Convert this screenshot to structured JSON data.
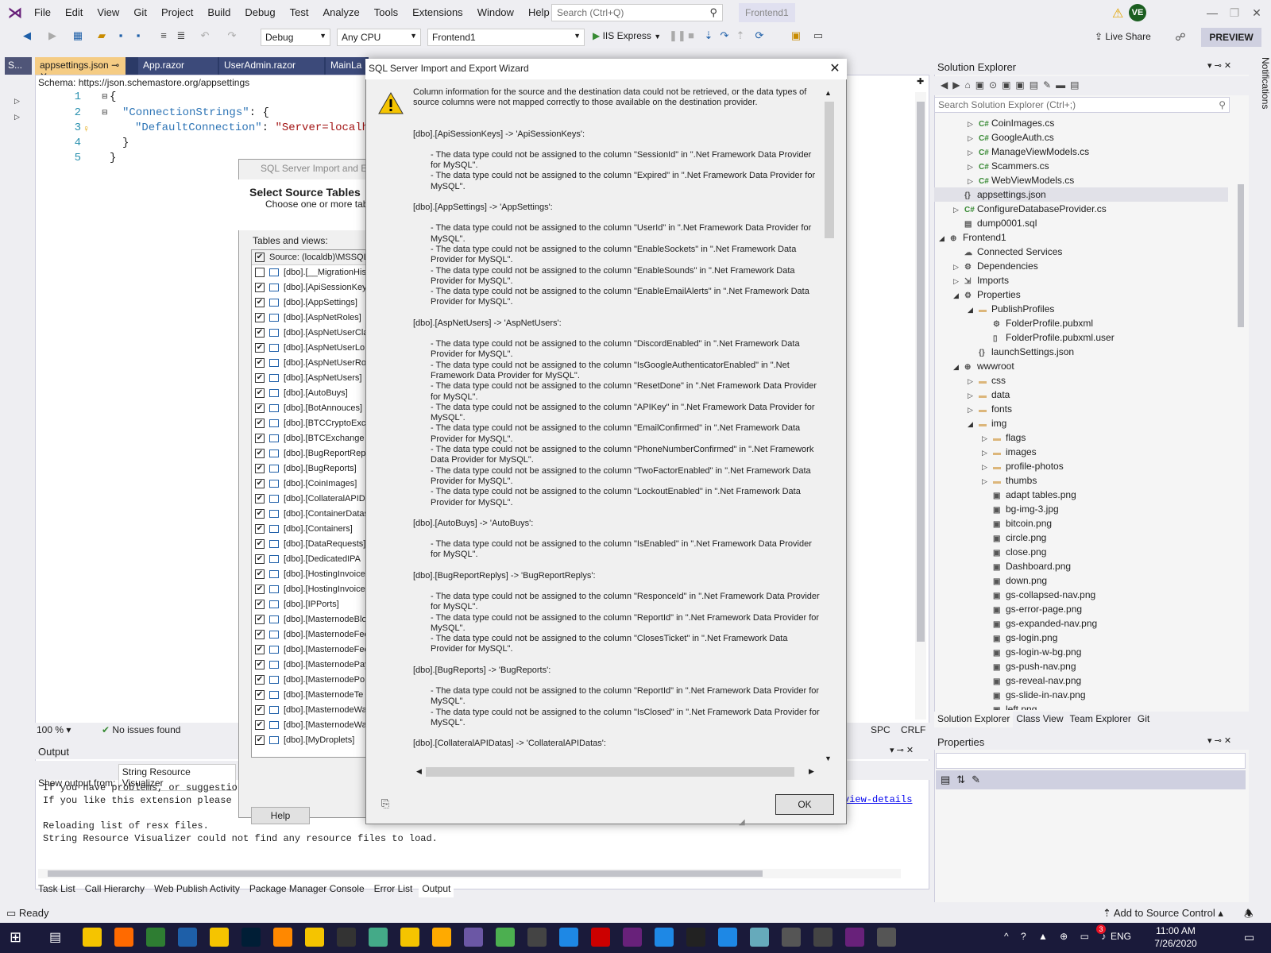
{
  "menu": {
    "items": [
      "File",
      "Edit",
      "View",
      "Git",
      "Project",
      "Build",
      "Debug",
      "Test",
      "Analyze",
      "Tools",
      "Extensions",
      "Window",
      "Help"
    ],
    "search_placeholder": "Search (Ctrl+Q)",
    "solution_name": "Frontend1",
    "avatar_initials": "VE"
  },
  "toolbar": {
    "config": "Debug",
    "platform": "Any CPU",
    "project": "Frontend1",
    "run_label": "IIS Express",
    "live_share": "Live Share",
    "preview": "PREVIEW"
  },
  "editor": {
    "left_tab": "S...",
    "tabs": [
      "appsettings.json",
      "App.razor",
      "UserAdmin.razor",
      "MainLa"
    ],
    "schema_label": "Schema:",
    "schema_url": "https://json.schemastore.org/appsettings",
    "line_numbers": [
      "1",
      "2",
      "3",
      "4",
      "5"
    ],
    "lines": {
      "l1": "{",
      "l2_key": "\"ConnectionStrings\"",
      "l2_rest": ": {",
      "l3_key": "\"DefaultConnection\"",
      "l3_sep": ": ",
      "l3_val": "\"Server=localho",
      "l4": "}",
      "l5": "}"
    },
    "zoom": "100 %",
    "issues": "No issues found",
    "status_right": [
      "SPC",
      "CRLF"
    ]
  },
  "output": {
    "title": "Output",
    "show_from_label": "Show output from:",
    "show_from_value": "String Resource Visualizer",
    "text": "If you have problems, or suggestion\nIf you like this extension please l\n\nReloading list of resx files.\nString Resource Visualizer could not find any resource files to load.",
    "link": "view-details"
  },
  "bottom_tabs": [
    "Task List",
    "Call Hierarchy",
    "Web Publish Activity",
    "Package Manager Console",
    "Error List",
    "Output"
  ],
  "status": {
    "ready": "Ready",
    "source_control": "Add to Source Control"
  },
  "taskbar": {
    "lang": "ENG",
    "time": "11:00 AM",
    "date": "7/26/2020",
    "badge": "3"
  },
  "solution_explorer": {
    "title": "Solution Explorer",
    "search_placeholder": "Search Solution Explorer (Ctrl+;)",
    "items": [
      {
        "indent": 2,
        "tw": "▷",
        "icon": "C#",
        "label": "CoinImages.cs"
      },
      {
        "indent": 2,
        "tw": "▷",
        "icon": "C#",
        "label": "GoogleAuth.cs"
      },
      {
        "indent": 2,
        "tw": "▷",
        "icon": "C#",
        "label": "ManageViewModels.cs"
      },
      {
        "indent": 2,
        "tw": "▷",
        "icon": "C#",
        "label": "Scammers.cs"
      },
      {
        "indent": 2,
        "tw": "▷",
        "icon": "C#",
        "label": "WebViewModels.cs"
      },
      {
        "indent": 1,
        "tw": "",
        "icon": "{}",
        "label": "appsettings.json"
      },
      {
        "indent": 1,
        "tw": "▷",
        "icon": "C#",
        "label": "ConfigureDatabaseProvider.cs"
      },
      {
        "indent": 1,
        "tw": "",
        "icon": "▤",
        "label": "dump0001.sql"
      },
      {
        "indent": 0,
        "tw": "◢",
        "icon": "⊕",
        "label": "Frontend1"
      },
      {
        "indent": 1,
        "tw": "",
        "icon": "☁",
        "label": "Connected Services"
      },
      {
        "indent": 1,
        "tw": "▷",
        "icon": "⚙",
        "label": "Dependencies"
      },
      {
        "indent": 1,
        "tw": "▷",
        "icon": "⇲",
        "label": "Imports"
      },
      {
        "indent": 1,
        "tw": "◢",
        "icon": "⚙",
        "label": "Properties"
      },
      {
        "indent": 2,
        "tw": "◢",
        "icon": "▬",
        "label": "PublishProfiles"
      },
      {
        "indent": 3,
        "tw": "",
        "icon": "⚙",
        "label": "FolderProfile.pubxml"
      },
      {
        "indent": 3,
        "tw": "",
        "icon": "▯",
        "label": "FolderProfile.pubxml.user"
      },
      {
        "indent": 2,
        "tw": "",
        "icon": "{}",
        "label": "launchSettings.json"
      },
      {
        "indent": 1,
        "tw": "◢",
        "icon": "⊕",
        "label": "wwwroot"
      },
      {
        "indent": 2,
        "tw": "▷",
        "icon": "▬",
        "label": "css"
      },
      {
        "indent": 2,
        "tw": "▷",
        "icon": "▬",
        "label": "data"
      },
      {
        "indent": 2,
        "tw": "▷",
        "icon": "▬",
        "label": "fonts"
      },
      {
        "indent": 2,
        "tw": "◢",
        "icon": "▬",
        "label": "img"
      },
      {
        "indent": 3,
        "tw": "▷",
        "icon": "▬",
        "label": "flags"
      },
      {
        "indent": 3,
        "tw": "▷",
        "icon": "▬",
        "label": "images"
      },
      {
        "indent": 3,
        "tw": "▷",
        "icon": "▬",
        "label": "profile-photos"
      },
      {
        "indent": 3,
        "tw": "▷",
        "icon": "▬",
        "label": "thumbs"
      },
      {
        "indent": 3,
        "tw": "",
        "icon": "▣",
        "label": "adapt tables.png"
      },
      {
        "indent": 3,
        "tw": "",
        "icon": "▣",
        "label": "bg-img-3.jpg"
      },
      {
        "indent": 3,
        "tw": "",
        "icon": "▣",
        "label": "bitcoin.png"
      },
      {
        "indent": 3,
        "tw": "",
        "icon": "▣",
        "label": "circle.png"
      },
      {
        "indent": 3,
        "tw": "",
        "icon": "▣",
        "label": "close.png"
      },
      {
        "indent": 3,
        "tw": "",
        "icon": "▣",
        "label": "Dashboard.png"
      },
      {
        "indent": 3,
        "tw": "",
        "icon": "▣",
        "label": "down.png"
      },
      {
        "indent": 3,
        "tw": "",
        "icon": "▣",
        "label": "gs-collapsed-nav.png"
      },
      {
        "indent": 3,
        "tw": "",
        "icon": "▣",
        "label": "gs-error-page.png"
      },
      {
        "indent": 3,
        "tw": "",
        "icon": "▣",
        "label": "gs-expanded-nav.png"
      },
      {
        "indent": 3,
        "tw": "",
        "icon": "▣",
        "label": "gs-login.png"
      },
      {
        "indent": 3,
        "tw": "",
        "icon": "▣",
        "label": "gs-login-w-bg.png"
      },
      {
        "indent": 3,
        "tw": "",
        "icon": "▣",
        "label": "gs-push-nav.png"
      },
      {
        "indent": 3,
        "tw": "",
        "icon": "▣",
        "label": "gs-reveal-nav.png"
      },
      {
        "indent": 3,
        "tw": "",
        "icon": "▣",
        "label": "gs-slide-in-nav.png"
      },
      {
        "indent": 3,
        "tw": "",
        "icon": "▣",
        "label": "left.png"
      }
    ],
    "tabs": [
      "Solution Explorer",
      "Class View",
      "Team Explorer",
      "Git"
    ]
  },
  "properties": {
    "title": "Properties"
  },
  "notifications": "Notifications",
  "wizard_bg": {
    "title": "SQL Server Import and Ex",
    "heading": "Select Source Tables",
    "subheading": "Choose one or more table",
    "tables_label": "Tables and views:",
    "header": "Source: (localdb)\\MSSQL",
    "rows": [
      {
        "checked": false,
        "name": "[dbo].[__MigrationHis"
      },
      {
        "checked": true,
        "name": "[dbo].[ApiSessionKey"
      },
      {
        "checked": true,
        "name": "[dbo].[AppSettings]"
      },
      {
        "checked": true,
        "name": "[dbo].[AspNetRoles]"
      },
      {
        "checked": true,
        "name": "[dbo].[AspNetUserCla"
      },
      {
        "checked": true,
        "name": "[dbo].[AspNetUserLo"
      },
      {
        "checked": true,
        "name": "[dbo].[AspNetUserRo"
      },
      {
        "checked": true,
        "name": "[dbo].[AspNetUsers]"
      },
      {
        "checked": true,
        "name": "[dbo].[AutoBuys]"
      },
      {
        "checked": true,
        "name": "[dbo].[BotAnnouces]"
      },
      {
        "checked": true,
        "name": "[dbo].[BTCCryptoExc"
      },
      {
        "checked": true,
        "name": "[dbo].[BTCExchange"
      },
      {
        "checked": true,
        "name": "[dbo].[BugReportRep"
      },
      {
        "checked": true,
        "name": "[dbo].[BugReports]"
      },
      {
        "checked": true,
        "name": "[dbo].[CoinImages]"
      },
      {
        "checked": true,
        "name": "[dbo].[CollateralAPID"
      },
      {
        "checked": true,
        "name": "[dbo].[ContainerDatas"
      },
      {
        "checked": true,
        "name": "[dbo].[Containers]"
      },
      {
        "checked": true,
        "name": "[dbo].[DataRequests]"
      },
      {
        "checked": true,
        "name": "[dbo].[DedicatedIPA"
      },
      {
        "checked": true,
        "name": "[dbo].[HostingInvoice"
      },
      {
        "checked": true,
        "name": "[dbo].[HostingInvoice"
      },
      {
        "checked": true,
        "name": "[dbo].[IPPorts]"
      },
      {
        "checked": true,
        "name": "[dbo].[MasternodeBlo"
      },
      {
        "checked": true,
        "name": "[dbo].[MasternodeFee"
      },
      {
        "checked": true,
        "name": "[dbo].[MasternodeFee"
      },
      {
        "checked": true,
        "name": "[dbo].[MasternodePay"
      },
      {
        "checked": true,
        "name": "[dbo].[MasternodePo"
      },
      {
        "checked": true,
        "name": "[dbo].[MasternodeTe"
      },
      {
        "checked": true,
        "name": "[dbo].[MasternodeWa"
      },
      {
        "checked": true,
        "name": "[dbo].[MasternodeWa"
      },
      {
        "checked": true,
        "name": "[dbo].[MyDroplets]"
      }
    ],
    "help": "Help"
  },
  "dialog": {
    "title": "SQL Server Import and Export Wizard",
    "intro": "Column information for the source and the destination data could not be retrieved, or the data types of source columns were not mapped correctly to those available on the destination provider.",
    "groups": [
      {
        "table": "[dbo].[ApiSessionKeys] -> 'ApiSessionKeys':",
        "items": [
          "- The data type could not be assigned to the column \"SessionId\" in \".Net Framework Data Provider for MySQL\".",
          "- The data type could not be assigned to the column \"Expired\" in \".Net Framework Data Provider for MySQL\"."
        ]
      },
      {
        "table": "[dbo].[AppSettings] -> 'AppSettings':",
        "items": [
          "- The data type could not be assigned to the column \"UserId\" in \".Net Framework Data Provider for MySQL\".",
          "- The data type could not be assigned to the column \"EnableSockets\" in \".Net Framework Data Provider for MySQL\".",
          "- The data type could not be assigned to the column \"EnableSounds\" in \".Net Framework Data Provider for MySQL\".",
          "- The data type could not be assigned to the column \"EnableEmailAlerts\" in \".Net Framework Data Provider for MySQL\"."
        ]
      },
      {
        "table": "[dbo].[AspNetUsers] -> 'AspNetUsers':",
        "items": [
          "- The data type could not be assigned to the column \"DiscordEnabled\" in \".Net Framework Data Provider for MySQL\".",
          "- The data type could not be assigned to the column \"IsGoogleAuthenticatorEnabled\" in \".Net Framework Data Provider for MySQL\".",
          "- The data type could not be assigned to the column \"ResetDone\" in \".Net Framework Data Provider for MySQL\".",
          "- The data type could not be assigned to the column \"APIKey\" in \".Net Framework Data Provider for MySQL\".",
          "- The data type could not be assigned to the column \"EmailConfirmed\" in \".Net Framework Data Provider for MySQL\".",
          "- The data type could not be assigned to the column \"PhoneNumberConfirmed\" in \".Net Framework Data Provider for MySQL\".",
          "- The data type could not be assigned to the column \"TwoFactorEnabled\" in \".Net Framework Data Provider for MySQL\".",
          "- The data type could not be assigned to the column \"LockoutEnabled\" in \".Net Framework Data Provider for MySQL\"."
        ]
      },
      {
        "table": "[dbo].[AutoBuys] -> 'AutoBuys':",
        "items": [
          "- The data type could not be assigned to the column \"IsEnabled\" in \".Net Framework Data Provider for MySQL\"."
        ]
      },
      {
        "table": "[dbo].[BugReportReplys] -> 'BugReportReplys':",
        "items": [
          "- The data type could not be assigned to the column \"ResponceId\" in \".Net Framework Data Provider for MySQL\".",
          "- The data type could not be assigned to the column \"ReportId\" in \".Net Framework Data Provider for MySQL\".",
          "- The data type could not be assigned to the column \"ClosesTicket\" in \".Net Framework Data Provider for MySQL\"."
        ]
      },
      {
        "table": "[dbo].[BugReports] -> 'BugReports':",
        "items": [
          "- The data type could not be assigned to the column \"ReportId\" in \".Net Framework Data Provider for MySQL\".",
          "- The data type could not be assigned to the column \"IsClosed\" in \".Net Framework Data Provider for MySQL\"."
        ]
      },
      {
        "table": "[dbo].[CollateralAPIDatas] -> 'CollateralAPIDatas':",
        "items": []
      }
    ],
    "ok": "OK"
  },
  "colors": {
    "accent": "#68217a",
    "tab_active": "#f5cc84",
    "warning": "#e2a300",
    "cs_icon": "#388a34"
  }
}
